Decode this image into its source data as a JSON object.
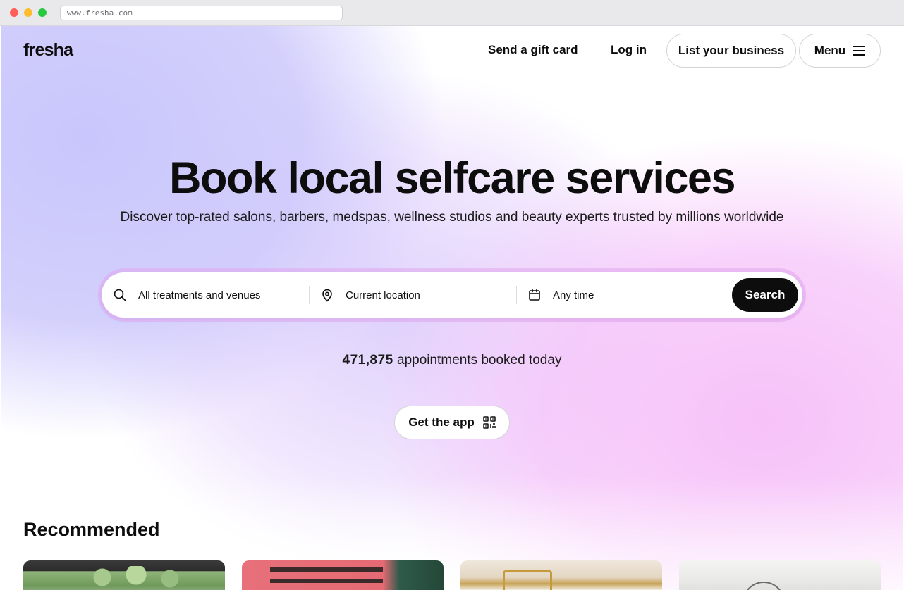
{
  "browser": {
    "url": "www.fresha.com"
  },
  "header": {
    "logo": "fresha",
    "gift_card": "Send a gift card",
    "login": "Log in",
    "list_business": "List your business",
    "menu": "Menu"
  },
  "hero": {
    "title": "Book local selfcare services",
    "subtitle": "Discover top-rated salons, barbers, medspas, wellness studios and beauty experts trusted by millions worldwide"
  },
  "search": {
    "treatments_placeholder": "All treatments and venues",
    "location_placeholder": "Current location",
    "time_placeholder": "Any time",
    "button": "Search"
  },
  "stats": {
    "count": "471,875",
    "label": "appointments booked today"
  },
  "app": {
    "button": "Get the app"
  },
  "recommended": {
    "title": "Recommended"
  },
  "colors": {
    "primary_button": "#0d0d0d",
    "gradient_purple": "#cac7fb",
    "gradient_pink": "#f6bef8"
  }
}
